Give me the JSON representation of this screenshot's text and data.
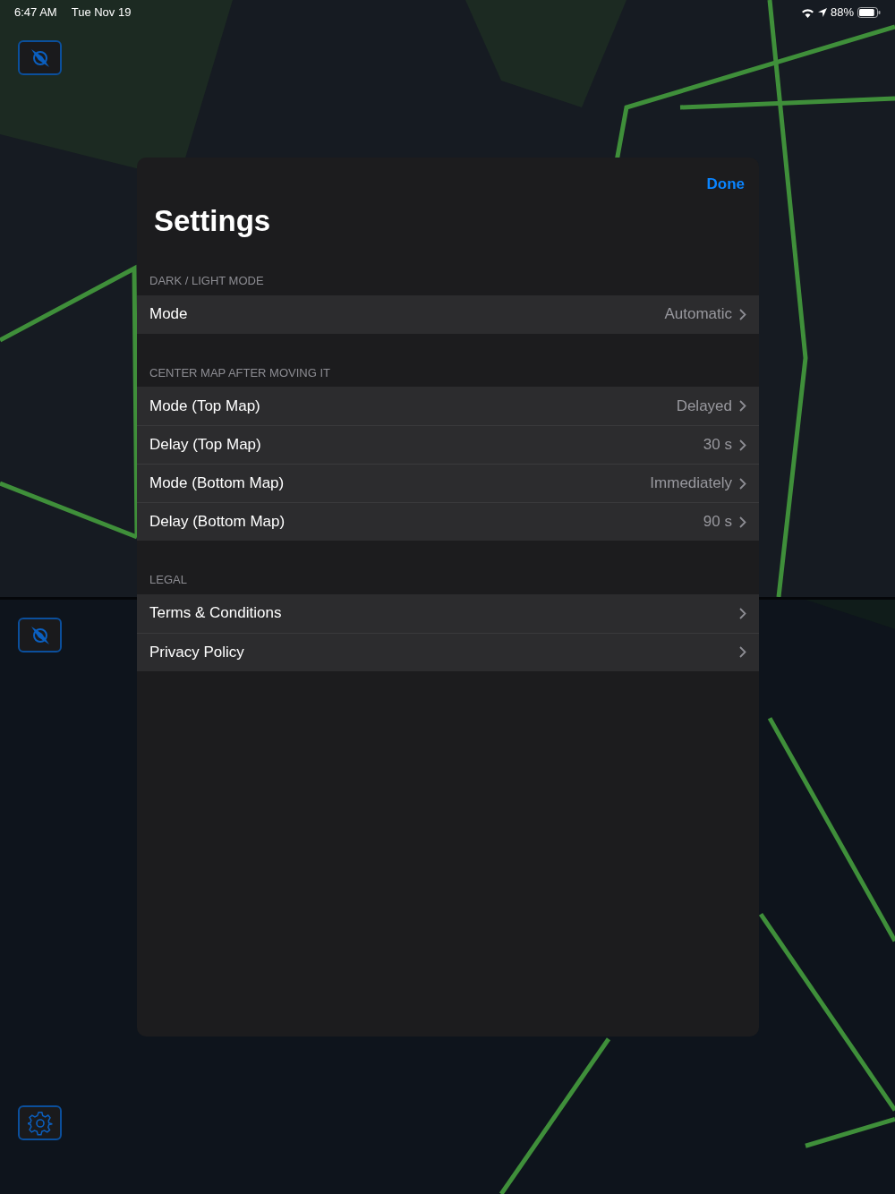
{
  "status_bar": {
    "time": "6:47 AM",
    "date": "Tue Nov 19",
    "battery": "88%"
  },
  "settings": {
    "done": "Done",
    "title": "Settings",
    "sections": [
      {
        "header": "DARK / LIGHT MODE",
        "rows": [
          {
            "label": "Mode",
            "value": "Automatic"
          }
        ]
      },
      {
        "header": "CENTER MAP AFTER MOVING IT",
        "rows": [
          {
            "label": "Mode (Top Map)",
            "value": "Delayed"
          },
          {
            "label": "Delay (Top Map)",
            "value": "30 s"
          },
          {
            "label": "Mode (Bottom Map)",
            "value": "Immediately"
          },
          {
            "label": "Delay (Bottom Map)",
            "value": "90 s"
          }
        ]
      },
      {
        "header": "LEGAL",
        "rows": [
          {
            "label": "Terms & Conditions"
          },
          {
            "label": "Privacy Policy"
          }
        ]
      }
    ]
  }
}
